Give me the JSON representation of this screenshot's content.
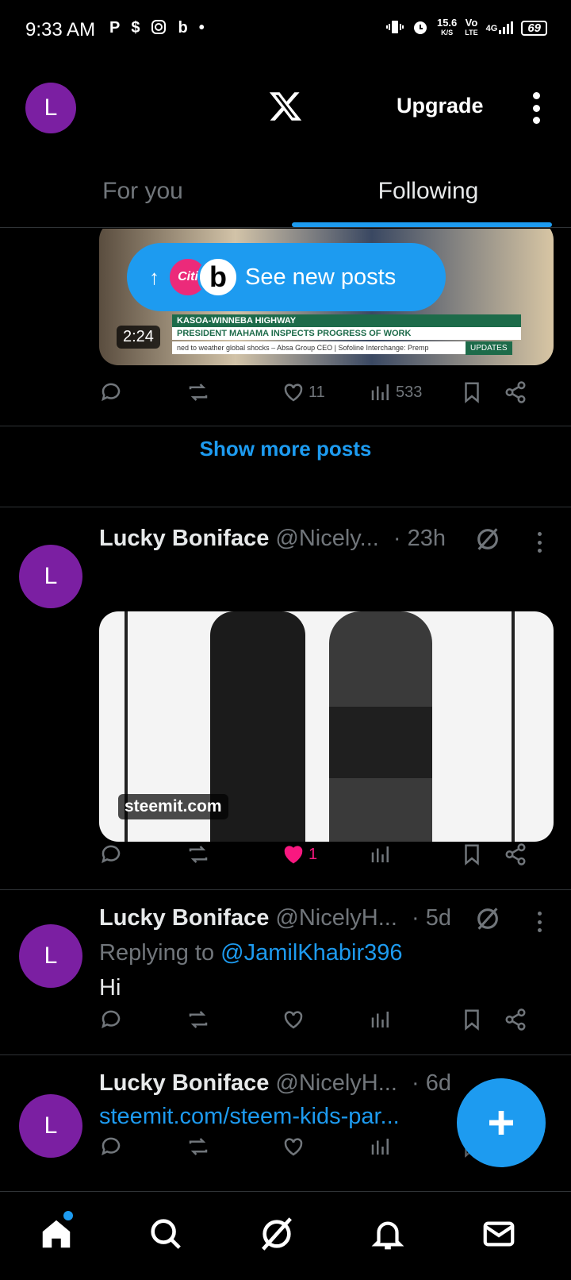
{
  "status_bar": {
    "time": "9:33 AM",
    "left_icons": [
      "P",
      "$",
      "instagram-icon",
      "b",
      "•"
    ],
    "net_speed_value": "15.6",
    "net_speed_unit": "K/S",
    "volte_top": "Vo",
    "volte_bottom": "LTE",
    "network": "4G",
    "battery": "69"
  },
  "header": {
    "avatar_letter": "L",
    "upgrade_label": "Upgrade"
  },
  "tabs": [
    {
      "label": "For you",
      "active": false
    },
    {
      "label": "Following",
      "active": true
    }
  ],
  "new_posts_pill": {
    "label": "See new posts",
    "avatar1_text": "Citi",
    "avatar2_text": "b"
  },
  "video_post": {
    "duration": "2:24",
    "lower_third": {
      "line1": "KASOA-WINNEBA HIGHWAY",
      "line2": "PRESIDENT MAHAMA INSPECTS PROGRESS OF WORK",
      "ticker": "ned to weather global shocks – Absa Group CEO  |  Sofoline Interchange: Premp",
      "tag": "UPDATES"
    },
    "likes": "11",
    "views": "533"
  },
  "show_more_label": "Show more posts",
  "posts": [
    {
      "avatar_letter": "L",
      "name": "Lucky Boniface",
      "handle": "@Nicely...",
      "time": "· 23h",
      "image_source": "steemit.com",
      "likes": "1",
      "liked": true
    },
    {
      "avatar_letter": "L",
      "name": "Lucky Boniface",
      "handle": "@NicelyH...",
      "time": "· 5d",
      "replying_prefix": "Replying to",
      "replying_to": "@JamilKhabir396",
      "text": "Hi"
    },
    {
      "avatar_letter": "L",
      "name": "Lucky Boniface",
      "handle": "@NicelyH...",
      "time": "· 6d",
      "link": "steemit.com/steem-kids-par..."
    }
  ],
  "colors": {
    "accent": "#1d9bf0",
    "like": "#f91880",
    "avatar": "#7b1fa2",
    "muted": "#71767b"
  },
  "bottom_nav": [
    "home-icon",
    "search-icon",
    "grok-icon",
    "notifications-icon",
    "messages-icon"
  ]
}
